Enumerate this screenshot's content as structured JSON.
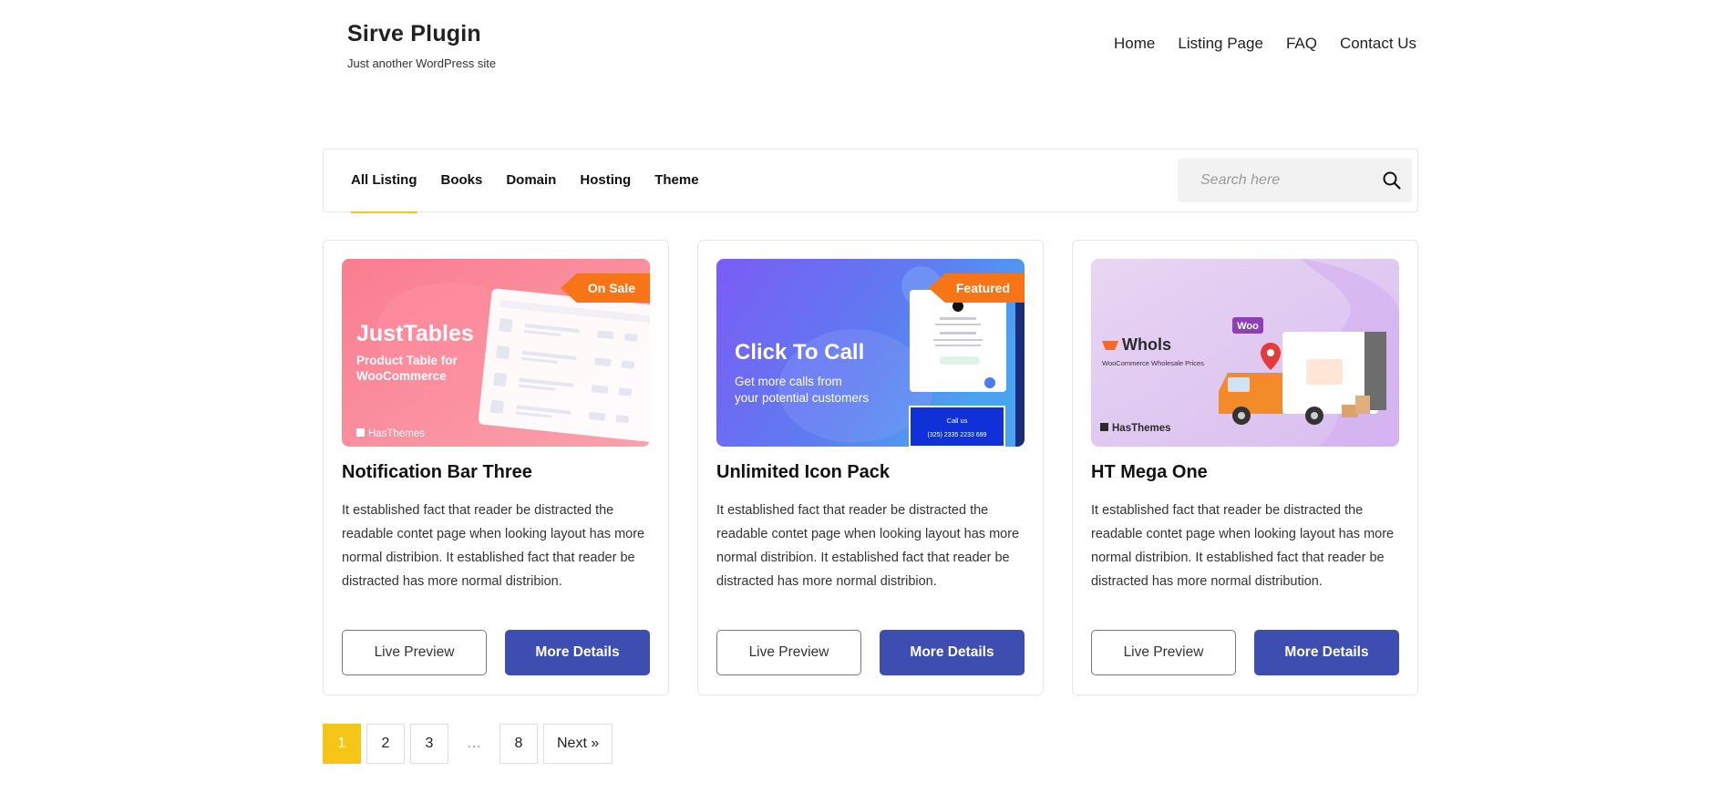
{
  "site": {
    "title": "Sirve Plugin",
    "tagline": "Just another WordPress site"
  },
  "nav": {
    "items": [
      "Home",
      "Listing Page",
      "FAQ",
      "Contact Us"
    ]
  },
  "filter": {
    "tabs": [
      "All Listing",
      "Books",
      "Domain",
      "Hosting",
      "Theme"
    ],
    "active_tab": "All Listing",
    "search_placeholder": "Search here"
  },
  "cards": [
    {
      "title": "Notification Bar Three",
      "badge": "On Sale",
      "description": "It established fact that reader be distracted the readable contet page when looking layout has more normal distribion. It established fact that reader be distracted has more normal distribion.",
      "preview_label": "Live Preview",
      "details_label": "More Details",
      "image": {
        "heading": "JustTables",
        "sub1": "Product Table for",
        "sub2": "WooCommerce",
        "brand": "HasThemes"
      }
    },
    {
      "title": "Unlimited Icon Pack",
      "badge": "Featured",
      "description": "It established fact that reader be distracted the readable contet page when looking layout has more normal distribion. It established fact that reader be distracted has more normal distribion.",
      "preview_label": "Live Preview",
      "details_label": "More Details",
      "image": {
        "heading": "Click To Call",
        "sub1": "Get more calls from",
        "sub2": "your potential customers",
        "callus": "Call us",
        "phone": "(325) 2335 2233 699"
      }
    },
    {
      "title": "HT Mega One",
      "badge": "",
      "description": "It established fact that reader be distracted the readable contet page when looking layout has more normal distribion. It established fact that reader be distracted has more normal distribution.",
      "preview_label": "Live Preview",
      "details_label": "More Details",
      "image": {
        "heading": "Whols",
        "sub1": "WooCommerce Wholesale Prices",
        "woo": "Woo",
        "brand": "HasThemes"
      }
    }
  ],
  "pagination": {
    "pages": [
      "1",
      "2",
      "3",
      "…",
      "8"
    ],
    "current": "1",
    "next_label": "Next »"
  },
  "colors": {
    "accent": "#f5c518",
    "primary_button": "#3d4db0",
    "badge": "#f77516"
  }
}
